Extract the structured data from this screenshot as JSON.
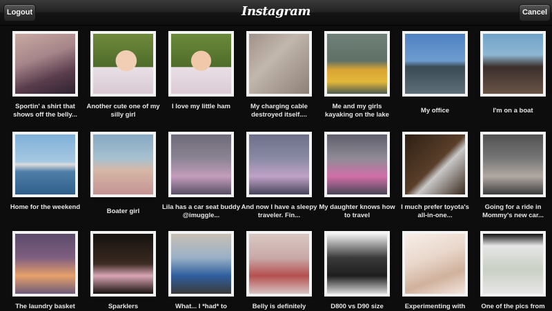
{
  "header": {
    "logout_label": "Logout",
    "title": "Instagram",
    "cancel_label": "Cancel"
  },
  "photos": [
    {
      "caption": "Sportin' a shirt that shows off the belly..."
    },
    {
      "caption": "Another cute one of my silly girl"
    },
    {
      "caption": "I love my little ham"
    },
    {
      "caption": "My charging cable destroyed itself...."
    },
    {
      "caption": "Me and my girls kayaking on the lake"
    },
    {
      "caption": "My office"
    },
    {
      "caption": "I'm on a boat"
    },
    {
      "caption": "Home for the weekend"
    },
    {
      "caption": "Boater girl"
    },
    {
      "caption": "Lila has a car seat buddy @imuggle..."
    },
    {
      "caption": "And now I have a sleepy traveler. Fin..."
    },
    {
      "caption": "My daughter knows how to travel"
    },
    {
      "caption": "I much prefer toyota's all-in-one..."
    },
    {
      "caption": "Going for a ride in Mommy's new car..."
    },
    {
      "caption": "The laundry basket"
    },
    {
      "caption": "Sparklers"
    },
    {
      "caption": "What... I *had* to"
    },
    {
      "caption": "Belly is definitely"
    },
    {
      "caption": "D800 vs D90 size"
    },
    {
      "caption": "Experimenting with"
    },
    {
      "caption": "One of the pics from"
    }
  ]
}
